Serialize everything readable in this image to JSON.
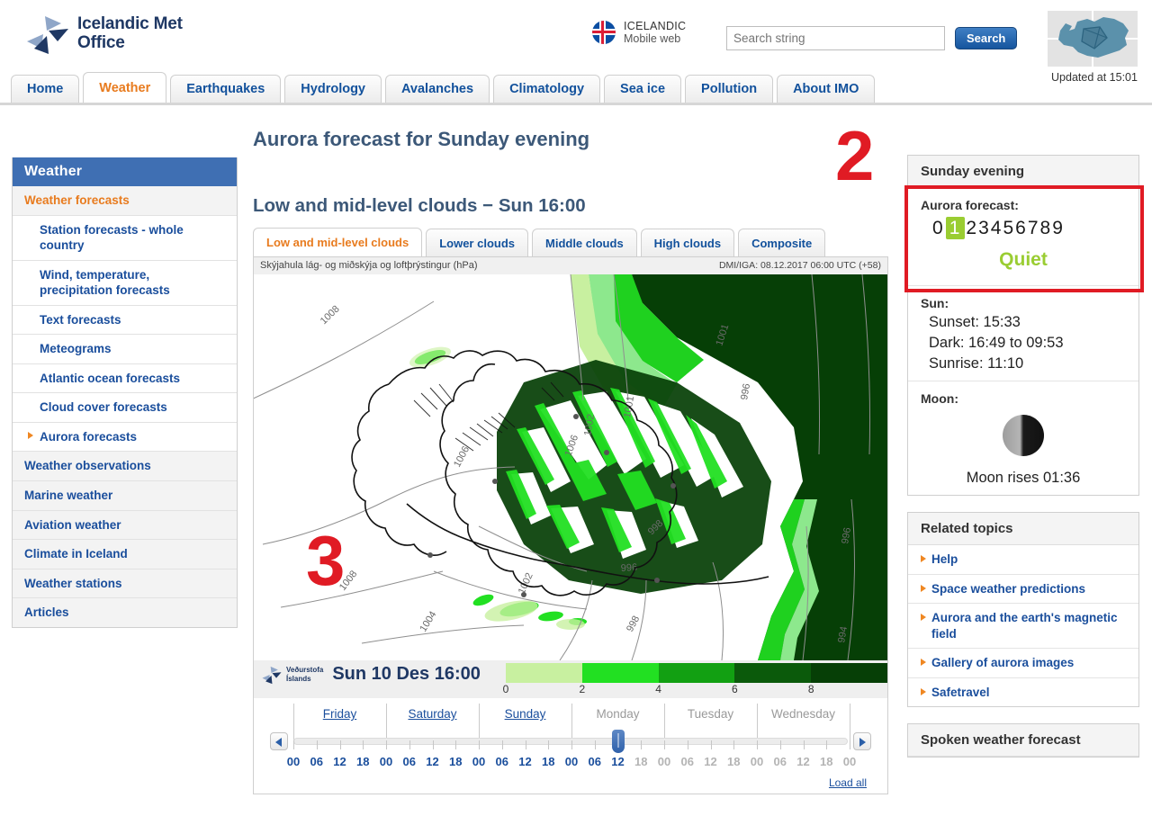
{
  "header": {
    "logo_line1": "Icelandic Met",
    "logo_line2": "Office",
    "logo_icon": "pinwheel-logo-icon",
    "lang_flag_icon": "iceland-flag-icon",
    "lang_main": "ICELANDIC",
    "lang_sub": "Mobile web",
    "search_placeholder": "Search string",
    "search_value": "",
    "search_button": "Search",
    "updated_text": "Updated at 15:01",
    "iceland_badge_icon": "iceland-map-icon"
  },
  "nav": {
    "tabs": [
      {
        "label": "Home",
        "active": false
      },
      {
        "label": "Weather",
        "active": true
      },
      {
        "label": "Earthquakes",
        "active": false
      },
      {
        "label": "Hydrology",
        "active": false
      },
      {
        "label": "Avalanches",
        "active": false
      },
      {
        "label": "Climatology",
        "active": false
      },
      {
        "label": "Sea ice",
        "active": false
      },
      {
        "label": "Pollution",
        "active": false
      },
      {
        "label": "About IMO",
        "active": false
      }
    ]
  },
  "sidebar": {
    "title": "Weather",
    "items": [
      {
        "label": "Weather forecasts",
        "level": 0,
        "state": "current"
      },
      {
        "label": "Station forecasts - whole country",
        "level": 1,
        "state": "normal"
      },
      {
        "label": "Wind, temperature, precipitation forecasts",
        "level": 1,
        "state": "normal"
      },
      {
        "label": "Text forecasts",
        "level": 1,
        "state": "normal"
      },
      {
        "label": "Meteograms",
        "level": 1,
        "state": "normal"
      },
      {
        "label": "Atlantic ocean forecasts",
        "level": 1,
        "state": "normal"
      },
      {
        "label": "Cloud cover forecasts",
        "level": 1,
        "state": "normal"
      },
      {
        "label": "Aurora forecasts",
        "level": 1,
        "state": "selected"
      },
      {
        "label": "Weather observations",
        "level": 0,
        "state": "normal"
      },
      {
        "label": "Marine weather",
        "level": 0,
        "state": "normal"
      },
      {
        "label": "Aviation weather",
        "level": 0,
        "state": "normal"
      },
      {
        "label": "Climate in Iceland",
        "level": 0,
        "state": "normal"
      },
      {
        "label": "Weather stations",
        "level": 0,
        "state": "normal"
      },
      {
        "label": "Articles",
        "level": 0,
        "state": "normal"
      }
    ]
  },
  "main": {
    "page_title": "Aurora forecast for Sunday evening",
    "section_title": "Low and mid-level clouds − Sun 16:00",
    "tabs": [
      {
        "label": "Low and mid-level clouds",
        "active": true
      },
      {
        "label": "Lower clouds",
        "active": false
      },
      {
        "label": "Middle clouds",
        "active": false
      },
      {
        "label": "High clouds",
        "active": false
      },
      {
        "label": "Composite",
        "active": false
      }
    ],
    "map": {
      "caption_left": "Skýjahula lág- og miðskýja og loftþrýstingur (hPa)",
      "caption_right": "DMI/IGA: 08.12.2017 06:00 UTC (+58)",
      "stamp_line1": "Veðurstofa",
      "stamp_line2": "Íslands",
      "stamp_time": "Sun 10 Des 16:00",
      "stamp_icon": "imo-pinwheel-icon",
      "contour_labels": [
        "1008",
        "1006",
        "1006",
        "1004",
        "1002",
        "1001",
        "1001",
        "1002",
        "996",
        "996",
        "998",
        "996",
        "994"
      ]
    },
    "legend": {
      "ticks": [
        "0",
        "2",
        "4",
        "6",
        "8"
      ],
      "colors": [
        "#c8f0a0",
        "#22e022",
        "#12a012",
        "#0b5a0b",
        "#063f06"
      ]
    },
    "timeline": {
      "days": [
        {
          "label": "Friday",
          "state": "past"
        },
        {
          "label": "Saturday",
          "state": "past"
        },
        {
          "label": "Sunday",
          "state": "past"
        },
        {
          "label": "Monday",
          "state": "future"
        },
        {
          "label": "Tuesday",
          "state": "future"
        },
        {
          "label": "Wednesday",
          "state": "future"
        }
      ],
      "hours": [
        "00",
        "06",
        "12",
        "18",
        "00",
        "06",
        "12",
        "18",
        "00",
        "06",
        "12",
        "18",
        "00",
        "06",
        "12",
        "18",
        "00",
        "06",
        "12",
        "18",
        "00",
        "06",
        "12",
        "18",
        "00"
      ],
      "active_hours_count": 14,
      "handle_index": 14,
      "arrow_left_icon": "chevron-left-icon",
      "arrow_right_icon": "chevron-right-icon",
      "load_all": "Load all"
    }
  },
  "right": {
    "forecast_panel_title": "Sunday evening",
    "aurora_label": "Aurora forecast:",
    "aurora_scale": [
      "0",
      "1",
      "2",
      "3",
      "4",
      "5",
      "6",
      "7",
      "8",
      "9"
    ],
    "aurora_value": 1,
    "aurora_word": "Quiet",
    "aurora_color": "#9acd32",
    "highlight_border_color": "#e01b24",
    "sun_label": "Sun:",
    "sun_lines": [
      "Sunset: 15:33",
      "Dark: 16:49 to 09:53",
      "Sunrise: 11:10"
    ],
    "moon_label": "Moon:",
    "moon_icon": "moon-phase-icon",
    "moon_text": "Moon rises 01:36",
    "related_title": "Related topics",
    "related_links": [
      "Help",
      "Space weather predictions",
      "Aurora and the earth's magnetic field",
      "Gallery of aurora images",
      "Safetravel"
    ],
    "spoken_title": "Spoken weather forecast"
  },
  "annotations": [
    {
      "text": "2",
      "color": "#e01b24"
    },
    {
      "text": "3",
      "color": "#e01b24"
    }
  ]
}
